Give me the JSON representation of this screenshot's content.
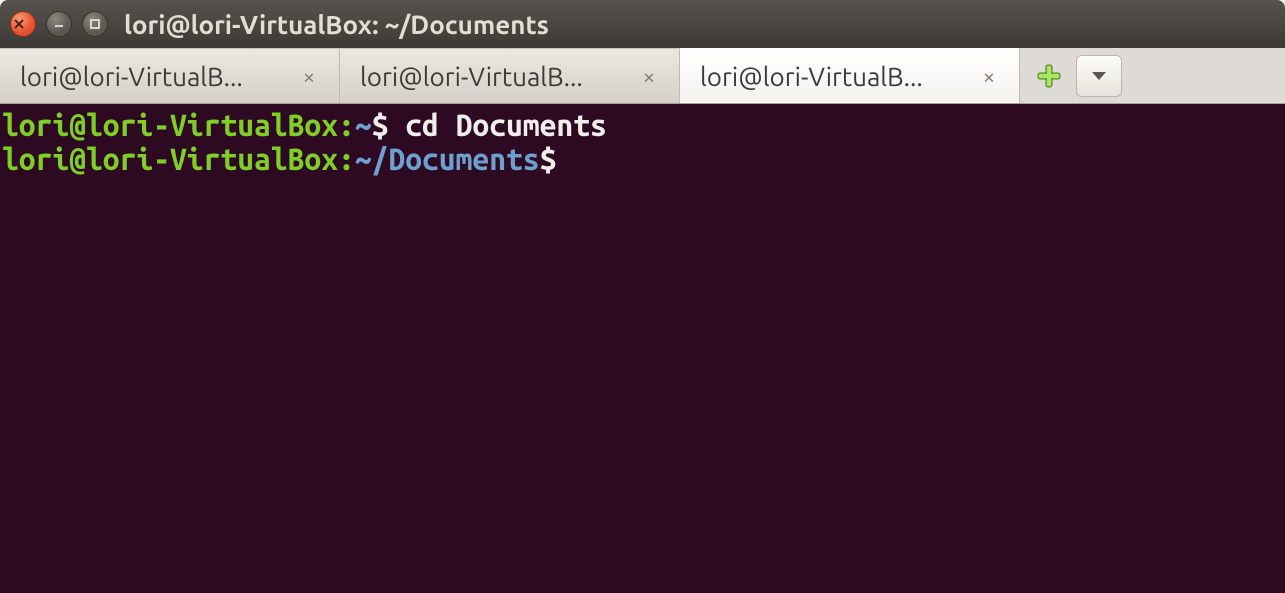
{
  "titlebar": {
    "title": "lori@lori-VirtualBox: ~/Documents"
  },
  "tabs": [
    {
      "label": "lori@lori-VirtualB...",
      "active": false
    },
    {
      "label": "lori@lori-VirtualB...",
      "active": false
    },
    {
      "label": "lori@lori-VirtualB...",
      "active": true
    }
  ],
  "tab_close_glyph": "×",
  "terminal": {
    "lines": [
      {
        "user": "lori@lori-VirtualBox",
        "sep": ":",
        "path": "~",
        "dollar": "$ ",
        "cmd": "cd Documents"
      },
      {
        "user": "lori@lori-VirtualBox",
        "sep": ":",
        "path": "~/Documents",
        "dollar": "$ ",
        "cmd": ""
      }
    ]
  }
}
